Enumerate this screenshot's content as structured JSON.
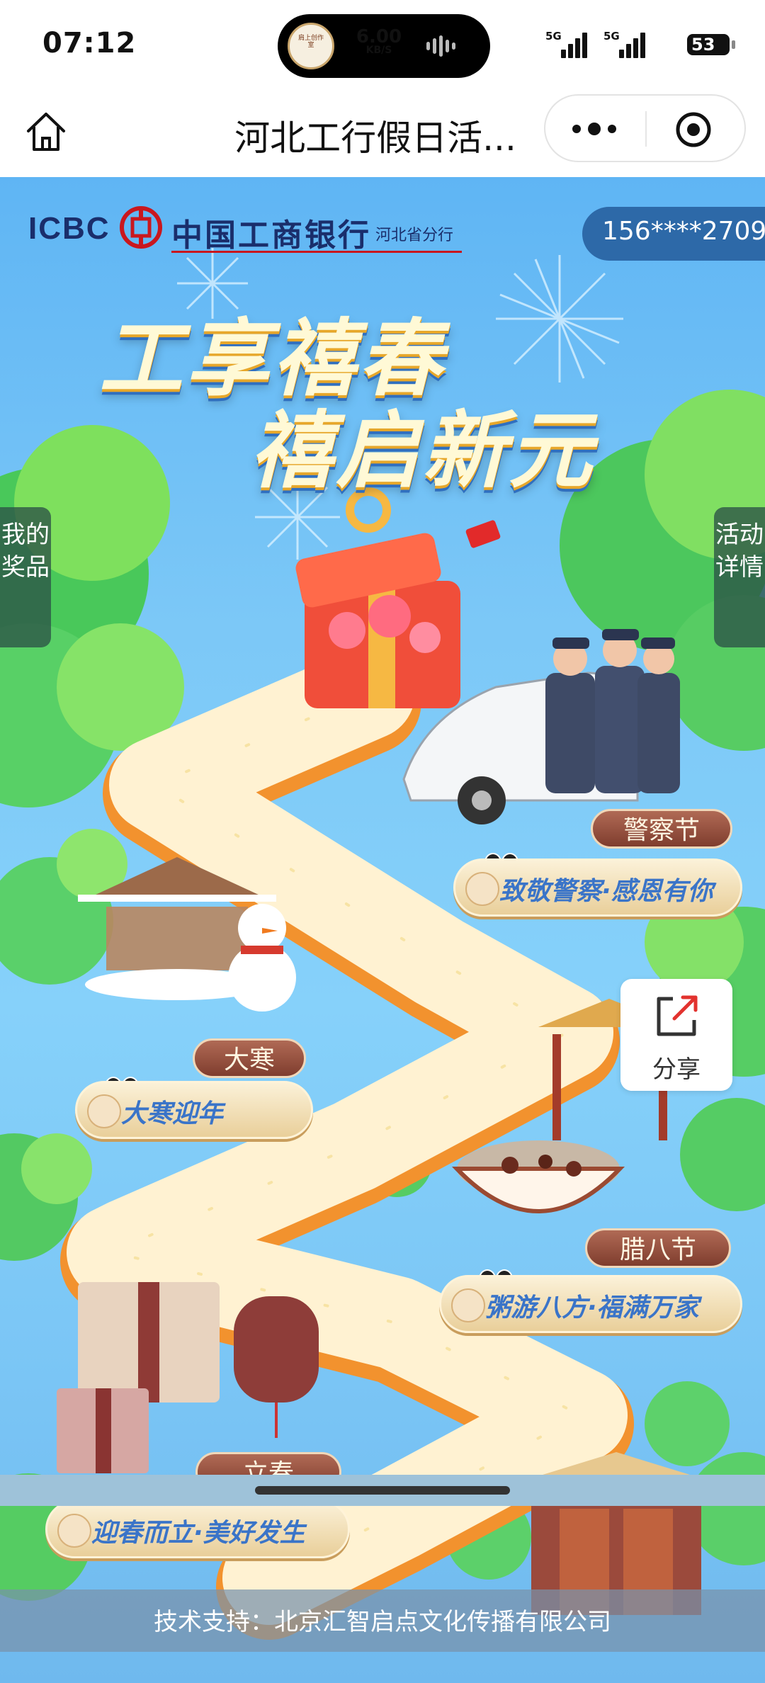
{
  "status_bar": {
    "time": "07:12",
    "net_speed_value": "6.00",
    "net_speed_unit": "KB/S",
    "sig1_label": "5G",
    "sig2_label": "5G",
    "battery": "53",
    "island_avatar_text": "肩上创作室"
  },
  "navbar": {
    "home_icon": "home-icon",
    "title": "河北工行假日活...",
    "more_icon": "more-dots-icon",
    "close_icon": "target-circle-icon"
  },
  "header": {
    "logo_en": "ICBC",
    "logo_cn": "中国工商银行",
    "logo_branch": "河北省分行",
    "phone": "156****2709"
  },
  "headline": {
    "line1": "工享禧春",
    "line2": "禧启新元"
  },
  "side_tabs": {
    "left": "我的奖品",
    "right": "活动详情"
  },
  "share": {
    "label": "分享",
    "icon": "share-external-icon"
  },
  "festivals": [
    {
      "tag": "警察节",
      "slogan": "致敬警察·感恩有你"
    },
    {
      "tag": "大寒",
      "slogan": "大寒迎年"
    },
    {
      "tag": "腊八节",
      "slogan": "粥游八方·福满万家"
    },
    {
      "tag": "立春",
      "slogan": "迎春而立·美好发生"
    }
  ],
  "footer": {
    "text": "技术支持：北京汇智启点文化传播有限公司"
  },
  "colors": {
    "sky": "#7cc8f7",
    "path_tile": "#fdf3c8",
    "path_edge": "#f2922e",
    "brand_navy": "#1a2e6b",
    "brand_red": "#c9171e",
    "banner_text": "#3a74c8"
  }
}
